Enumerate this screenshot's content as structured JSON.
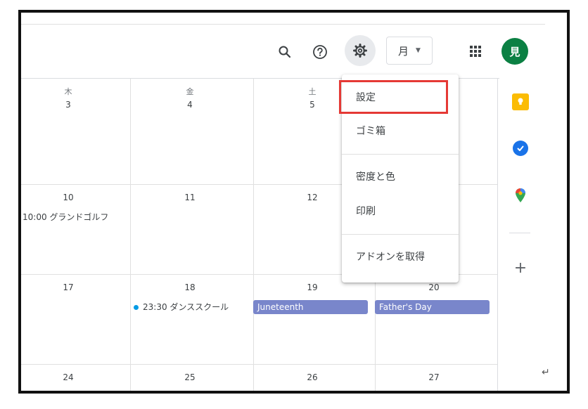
{
  "header": {
    "view_label": "月",
    "avatar_initial": "見"
  },
  "calendar": {
    "weekdays": [
      "木",
      "金",
      "土"
    ],
    "row1_dates": [
      "3",
      "4",
      "5"
    ],
    "row2_dates": [
      "10",
      "11",
      "12"
    ],
    "row3_dates": [
      "17",
      "18",
      "19",
      "20"
    ],
    "row4_dates": [
      "24",
      "25",
      "26",
      "27"
    ],
    "events": {
      "golf": "10:00 グランドゴルフ",
      "dance": "23:30 ダンススクール",
      "juneteenth": "Juneteenth",
      "fathers_day": "Father's Day"
    }
  },
  "menu": {
    "items": [
      "設定",
      "ゴミ箱",
      "密度と色",
      "印刷",
      "アドオンを取得"
    ]
  },
  "colors": {
    "accent_red": "#e53935",
    "avatar_green": "#0b8043",
    "event_chip": "#7986cb",
    "event_dot": "#039be5"
  }
}
